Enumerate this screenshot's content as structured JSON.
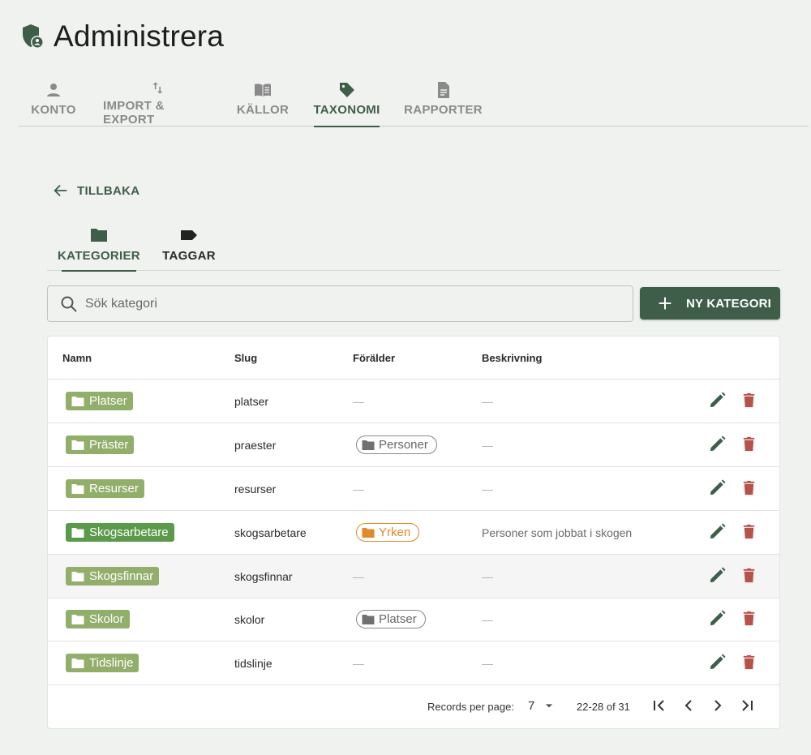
{
  "app": {
    "title": "Administrera"
  },
  "main_tabs": [
    {
      "label": "KONTO",
      "icon": "person-icon",
      "active": false
    },
    {
      "label": "IMPORT & EXPORT",
      "icon": "swap-vertical-icon",
      "active": false
    },
    {
      "label": "KÄLLOR",
      "icon": "book-icon",
      "active": false
    },
    {
      "label": "TAXONOMI",
      "icon": "tag-icon",
      "active": true
    },
    {
      "label": "RAPPORTER",
      "icon": "document-icon",
      "active": false
    }
  ],
  "back": {
    "label": "TILLBAKA"
  },
  "sub_tabs": [
    {
      "label": "KATEGORIER",
      "icon": "folder-icon",
      "active": true
    },
    {
      "label": "TAGGAR",
      "icon": "label-icon",
      "active": false
    }
  ],
  "search": {
    "placeholder": "Sök kategori",
    "value": ""
  },
  "new_button": {
    "label": "NY KATEGORI"
  },
  "table": {
    "headers": {
      "name": "Namn",
      "slug": "Slug",
      "parent": "Förälder",
      "description": "Beskrivning"
    },
    "empty": "—",
    "rows": [
      {
        "name": "Platser",
        "slug": "platser",
        "parent": "",
        "description": ""
      },
      {
        "name": "Präster",
        "slug": "praester",
        "parent": "Personer",
        "description": ""
      },
      {
        "name": "Resurser",
        "slug": "resurser",
        "parent": "",
        "description": ""
      },
      {
        "name": "Skogsarbetare",
        "slug": "skogsarbetare",
        "parent": "Yrken",
        "description": "Personer som jobbat i skogen"
      },
      {
        "name": "Skogsfinnar",
        "slug": "skogsfinnar",
        "parent": "",
        "description": ""
      },
      {
        "name": "Skolor",
        "slug": "skolor",
        "parent": "Platser",
        "description": ""
      },
      {
        "name": "Tidslinje",
        "slug": "tidslinje",
        "parent": "",
        "description": ""
      }
    ]
  },
  "footer": {
    "rows_per_page_label": "Records per page:",
    "rows_per_page": "7",
    "range": "22-28 of 31"
  },
  "colors": {
    "primary": "#3f5e4a",
    "chip": "#92ae6b",
    "chip_dark": "#5b9a4b",
    "delete": "#b5534a",
    "parent_orange": "#e08a2a",
    "background": "#eff2ee"
  }
}
